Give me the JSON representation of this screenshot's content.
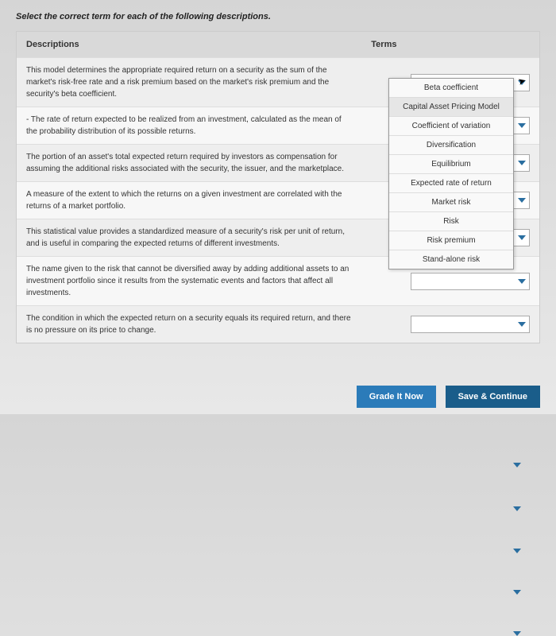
{
  "instruction": "Select the correct term for each of the following descriptions.",
  "headers": {
    "left": "Descriptions",
    "right": "Terms"
  },
  "rows": [
    "This model determines the appropriate required return on a security as the sum of the market's risk-free rate and a risk premium based on the market's risk premium and the security's beta coefficient.",
    "- The rate of return expected to be realized from an investment, calculated as the mean of the probability distribution of its possible returns.",
    "The portion of an asset's total expected return required by investors as compensation for assuming the additional risks associated with the security, the issuer, and the marketplace.",
    "A measure of the extent to which the returns on a given investment are correlated with the returns of a market portfolio.",
    "This statistical value provides a standardized measure of a security's risk per unit of return, and is useful in comparing the expected returns of different investments.",
    "The name given to the risk that cannot be diversified away by adding additional assets to an investment portfolio since it results from the systematic events and factors that affect all investments.",
    "The condition in which the expected return on a security equals its required return, and there is no pressure on its price to change."
  ],
  "options": [
    "Beta coefficient",
    "Capital Asset Pricing Model",
    "Coefficient of variation",
    "Diversification",
    "Equilibrium",
    "Expected rate of return",
    "Market risk",
    "Risk",
    "Risk premium",
    "Stand-alone risk"
  ],
  "buttons": {
    "grade": "Grade It Now",
    "save": "Save & Continue"
  }
}
